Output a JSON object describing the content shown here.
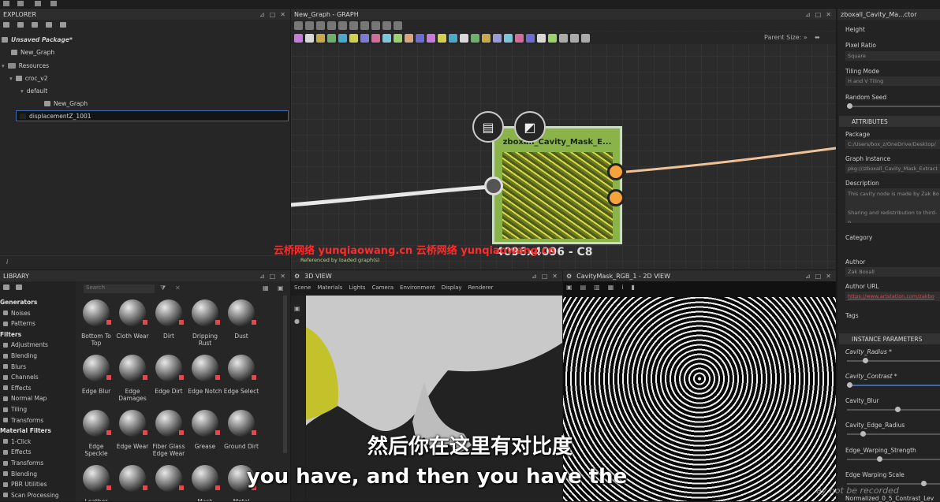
{
  "explorer": {
    "title": "EXPLORER",
    "items": [
      {
        "label": "Unsaved Package*",
        "level": 0
      },
      {
        "label": "New_Graph",
        "level": 1
      },
      {
        "label": "Resources",
        "level": 1
      },
      {
        "label": "croc_v2",
        "level": 2
      },
      {
        "label": "default",
        "level": 3
      },
      {
        "label": "New_Graph",
        "level": 4
      },
      {
        "label": "displacementZ_1001",
        "level": 1
      }
    ]
  },
  "graph": {
    "title": "New_Graph - GRAPH",
    "parent_size_label": "Parent Size:",
    "parent_size_value": "»",
    "node_title": "zboxall_Cavity_Mask_E...",
    "node_size": "4096x4096 - C8",
    "referenced_text": "Referenced by loaded graph(s)",
    "watermark": "云桥网络 yunqiaowang.cn 云桥网络 yunqiaowang.cn"
  },
  "library": {
    "title": "LIBRARY",
    "search_placeholder": "Search",
    "categories": [
      {
        "label": "Generators",
        "header": true
      },
      {
        "label": "Noises",
        "header": false
      },
      {
        "label": "Patterns",
        "header": false
      },
      {
        "label": "Filters",
        "header": true
      },
      {
        "label": "Adjustments",
        "header": false
      },
      {
        "label": "Blending",
        "header": false
      },
      {
        "label": "Blurs",
        "header": false
      },
      {
        "label": "Channels",
        "header": false
      },
      {
        "label": "Effects",
        "header": false
      },
      {
        "label": "Normal Map",
        "header": false
      },
      {
        "label": "Tiling",
        "header": false
      },
      {
        "label": "Transforms",
        "header": false
      },
      {
        "label": "Material Filters",
        "header": true
      },
      {
        "label": "1-Click",
        "header": false
      },
      {
        "label": "Effects",
        "header": false
      },
      {
        "label": "Transforms",
        "header": false
      },
      {
        "label": "Blending",
        "header": false
      },
      {
        "label": "PBR Utilities",
        "header": false
      },
      {
        "label": "Scan Processing",
        "header": false
      }
    ],
    "materials": [
      [
        "Bottom To Top",
        "Cloth Wear",
        "Dirt",
        "Dripping Rust",
        "Dust"
      ],
      [
        "Edge Blur",
        "Edge Damages",
        "Edge Dirt",
        "Edge Notch",
        "Edge Select"
      ],
      [
        "Edge Speckle",
        "Edge Wear",
        "Fiber Glass Edge Wear",
        "Grease",
        "Ground Dirt"
      ],
      [
        "Leather",
        "",
        "",
        "Mask",
        "Metal"
      ]
    ]
  },
  "view3d": {
    "title": "3D VIEW",
    "menu": [
      "Scene",
      "Materials",
      "Lights",
      "Camera",
      "Environment",
      "Display",
      "Renderer"
    ]
  },
  "view2d": {
    "title": "CavityMask_RGB_1 - 2D VIEW"
  },
  "properties": {
    "title": "zboxall_Cavity_Ma...ctor",
    "top_fields": [
      {
        "label": "Height",
        "value": ""
      },
      {
        "label": "Pixel Ratio",
        "value": "Square"
      },
      {
        "label": "Tiling Mode",
        "value": "H and V Tiling"
      },
      {
        "label": "Random Seed",
        "value": ""
      }
    ],
    "attributes_header": "ATTRIBUTES",
    "attributes": [
      {
        "label": "Package",
        "value": "C:/Users/box_z/OneDrive/Desktop/"
      },
      {
        "label": "Graph instance",
        "value": "pkg:///zboxall_Cavity_Mask_Extract"
      },
      {
        "label": "Description",
        "value": "This cavity node is made by Zak Bo"
      },
      {
        "label": "",
        "value": "Sharing and redistribution to third-p"
      },
      {
        "label": "Category",
        "value": ""
      },
      {
        "label": "Author",
        "value": "Zak Boxall"
      },
      {
        "label": "Author URL",
        "value": "https://www.artstation.com/zakbo"
      },
      {
        "label": "Tags",
        "value": ""
      }
    ],
    "instance_header": "INSTANCE PARAMETERS",
    "params": [
      {
        "label": "Cavity_Radius *",
        "level": 0.18
      },
      {
        "label": "Cavity_Contrast *",
        "level": 0.0
      },
      {
        "label": "Cavity_Blur",
        "level": 0.55
      },
      {
        "label": "Cavity_Edge_Radius",
        "level": 0.15
      },
      {
        "label": "Edge_Warping_Strength",
        "level": 0.34
      },
      {
        "label": "Edge Warping Scale",
        "level": 0.85
      },
      {
        "label": "Normalized_0_5_Contrast_Lev",
        "level": 0.0
      }
    ]
  },
  "subtitles": {
    "chinese": "然后你在这里有对比度",
    "english": "you have, and then you have the",
    "ghost_text": "ay not be recorded"
  },
  "colors": {
    "accent_orange": "#f5a33a",
    "node_green": "#8ab34a",
    "selection_blue": "#3a6aa8",
    "url_red": "#e04a4a"
  }
}
